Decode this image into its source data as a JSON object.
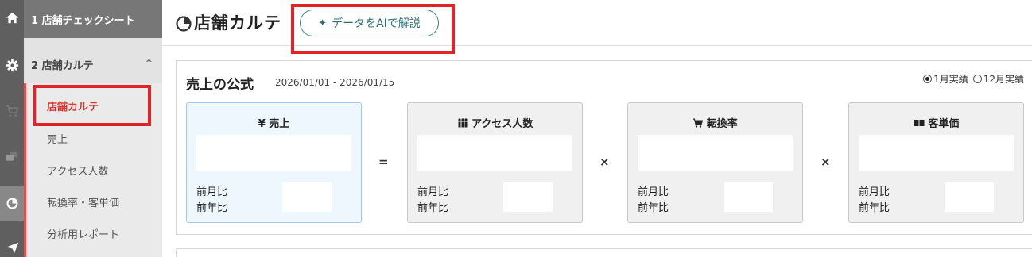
{
  "sidebar": {
    "section1": {
      "label": "1  店舗チェックシート"
    },
    "section2": {
      "label": "2  店舗カルテ",
      "chevron": "^"
    },
    "items": [
      {
        "label": "店舗カルテ",
        "active": true
      },
      {
        "label": "売上",
        "active": false
      },
      {
        "label": "アクセス人数",
        "active": false
      },
      {
        "label": "転換率・客単価",
        "active": false
      },
      {
        "label": "分析用レポート",
        "active": false
      }
    ],
    "rail_icons": [
      "home-icon",
      "gear-icon",
      "cart-icon",
      "chat-icon",
      "chart-pie-icon",
      "send-icon"
    ]
  },
  "header": {
    "title": "店舗カルテ",
    "ai_button_label": "データをAIで解説"
  },
  "formula": {
    "title": "売上の公式",
    "range": "2026/01/01 - 2026/01/15",
    "radio_options": [
      {
        "label": "1月実績",
        "selected": true
      },
      {
        "label": "12月実績",
        "selected": false
      }
    ],
    "metrics": [
      {
        "icon": "yen-icon",
        "icon_text": "¥",
        "title": "売上",
        "mom_label": "前月比",
        "yoy_label": "前年比"
      },
      {
        "icon": "people-icon",
        "title": "アクセス人数",
        "mom_label": "前月比",
        "yoy_label": "前年比"
      },
      {
        "icon": "cart-icon",
        "title": "転換率",
        "mom_label": "前月比",
        "yoy_label": "前年比"
      },
      {
        "icon": "card-icon",
        "title": "客単価",
        "mom_label": "前月比",
        "yoy_label": "前年比"
      }
    ],
    "operators": [
      "=",
      "×",
      "×"
    ]
  },
  "colors": {
    "highlight": "#e3232a",
    "active_menu_text": "#d9362f",
    "ai_button": "#2f6f72"
  }
}
